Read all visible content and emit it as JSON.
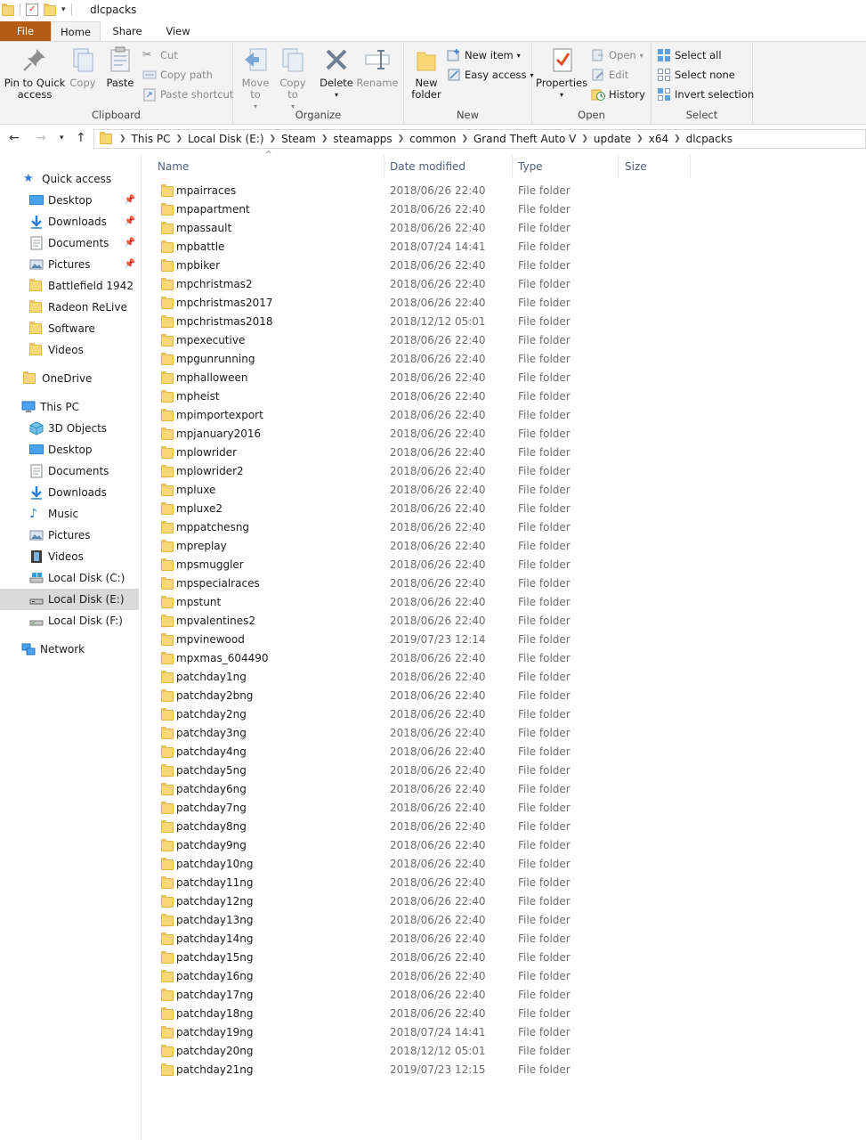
{
  "window": {
    "title": "dlcpacks",
    "qat_dropdown_icon": "chevron-down-icon"
  },
  "ribbon_tabs": {
    "file": "File",
    "home": "Home",
    "share": "Share",
    "view": "View"
  },
  "ribbon": {
    "clipboard": {
      "label": "Clipboard",
      "pin_to_quick_access": "Pin to Quick access",
      "copy": "Copy",
      "paste": "Paste",
      "cut": "Cut",
      "copy_path": "Copy path",
      "paste_shortcut": "Paste shortcut"
    },
    "organize": {
      "label": "Organize",
      "move_to": "Move to",
      "copy_to": "Copy to",
      "delete": "Delete",
      "rename": "Rename"
    },
    "new": {
      "label": "New",
      "new_folder": "New folder",
      "new_item": "New item",
      "easy_access": "Easy access"
    },
    "open": {
      "label": "Open",
      "properties": "Properties",
      "open": "Open",
      "edit": "Edit",
      "history": "History"
    },
    "select": {
      "label": "Select",
      "select_all": "Select all",
      "select_none": "Select none",
      "invert_selection": "Invert selection"
    }
  },
  "address": {
    "crumbs": [
      "This PC",
      "Local Disk (E:)",
      "Steam",
      "steamapps",
      "common",
      "Grand Theft Auto V",
      "update",
      "x64",
      "dlcpacks"
    ]
  },
  "nav": {
    "quick_access": "Quick access",
    "quick_items": [
      "Desktop",
      "Downloads",
      "Documents",
      "Pictures",
      "Battlefield 1942",
      "Radeon ReLive",
      "Software",
      "Videos"
    ],
    "onedrive": "OneDrive",
    "this_pc": "This PC",
    "pc_items": [
      "3D Objects",
      "Desktop",
      "Documents",
      "Downloads",
      "Music",
      "Pictures",
      "Videos",
      "Local Disk (C:)",
      "Local Disk (E:)",
      "Local Disk (F:)"
    ],
    "network": "Network",
    "selected": "Local Disk (E:)"
  },
  "columns": {
    "name": "Name",
    "date_modified": "Date modified",
    "type": "Type",
    "size": "Size"
  },
  "files": [
    {
      "name": "mpairraces",
      "date": "2018/06/26 22:40",
      "type": "File folder"
    },
    {
      "name": "mpapartment",
      "date": "2018/06/26 22:40",
      "type": "File folder"
    },
    {
      "name": "mpassault",
      "date": "2018/06/26 22:40",
      "type": "File folder"
    },
    {
      "name": "mpbattle",
      "date": "2018/07/24 14:41",
      "type": "File folder"
    },
    {
      "name": "mpbiker",
      "date": "2018/06/26 22:40",
      "type": "File folder"
    },
    {
      "name": "mpchristmas2",
      "date": "2018/06/26 22:40",
      "type": "File folder"
    },
    {
      "name": "mpchristmas2017",
      "date": "2018/06/26 22:40",
      "type": "File folder"
    },
    {
      "name": "mpchristmas2018",
      "date": "2018/12/12 05:01",
      "type": "File folder"
    },
    {
      "name": "mpexecutive",
      "date": "2018/06/26 22:40",
      "type": "File folder"
    },
    {
      "name": "mpgunrunning",
      "date": "2018/06/26 22:40",
      "type": "File folder"
    },
    {
      "name": "mphalloween",
      "date": "2018/06/26 22:40",
      "type": "File folder"
    },
    {
      "name": "mpheist",
      "date": "2018/06/26 22:40",
      "type": "File folder"
    },
    {
      "name": "mpimportexport",
      "date": "2018/06/26 22:40",
      "type": "File folder"
    },
    {
      "name": "mpjanuary2016",
      "date": "2018/06/26 22:40",
      "type": "File folder"
    },
    {
      "name": "mplowrider",
      "date": "2018/06/26 22:40",
      "type": "File folder"
    },
    {
      "name": "mplowrider2",
      "date": "2018/06/26 22:40",
      "type": "File folder"
    },
    {
      "name": "mpluxe",
      "date": "2018/06/26 22:40",
      "type": "File folder"
    },
    {
      "name": "mpluxe2",
      "date": "2018/06/26 22:40",
      "type": "File folder"
    },
    {
      "name": "mppatchesng",
      "date": "2018/06/26 22:40",
      "type": "File folder"
    },
    {
      "name": "mpreplay",
      "date": "2018/06/26 22:40",
      "type": "File folder"
    },
    {
      "name": "mpsmuggler",
      "date": "2018/06/26 22:40",
      "type": "File folder"
    },
    {
      "name": "mpspecialraces",
      "date": "2018/06/26 22:40",
      "type": "File folder"
    },
    {
      "name": "mpstunt",
      "date": "2018/06/26 22:40",
      "type": "File folder"
    },
    {
      "name": "mpvalentines2",
      "date": "2018/06/26 22:40",
      "type": "File folder"
    },
    {
      "name": "mpvinewood",
      "date": "2019/07/23 12:14",
      "type": "File folder"
    },
    {
      "name": "mpxmas_604490",
      "date": "2018/06/26 22:40",
      "type": "File folder"
    },
    {
      "name": "patchday1ng",
      "date": "2018/06/26 22:40",
      "type": "File folder"
    },
    {
      "name": "patchday2bng",
      "date": "2018/06/26 22:40",
      "type": "File folder"
    },
    {
      "name": "patchday2ng",
      "date": "2018/06/26 22:40",
      "type": "File folder"
    },
    {
      "name": "patchday3ng",
      "date": "2018/06/26 22:40",
      "type": "File folder"
    },
    {
      "name": "patchday4ng",
      "date": "2018/06/26 22:40",
      "type": "File folder"
    },
    {
      "name": "patchday5ng",
      "date": "2018/06/26 22:40",
      "type": "File folder"
    },
    {
      "name": "patchday6ng",
      "date": "2018/06/26 22:40",
      "type": "File folder"
    },
    {
      "name": "patchday7ng",
      "date": "2018/06/26 22:40",
      "type": "File folder"
    },
    {
      "name": "patchday8ng",
      "date": "2018/06/26 22:40",
      "type": "File folder"
    },
    {
      "name": "patchday9ng",
      "date": "2018/06/26 22:40",
      "type": "File folder"
    },
    {
      "name": "patchday10ng",
      "date": "2018/06/26 22:40",
      "type": "File folder"
    },
    {
      "name": "patchday11ng",
      "date": "2018/06/26 22:40",
      "type": "File folder"
    },
    {
      "name": "patchday12ng",
      "date": "2018/06/26 22:40",
      "type": "File folder"
    },
    {
      "name": "patchday13ng",
      "date": "2018/06/26 22:40",
      "type": "File folder"
    },
    {
      "name": "patchday14ng",
      "date": "2018/06/26 22:40",
      "type": "File folder"
    },
    {
      "name": "patchday15ng",
      "date": "2018/06/26 22:40",
      "type": "File folder"
    },
    {
      "name": "patchday16ng",
      "date": "2018/06/26 22:40",
      "type": "File folder"
    },
    {
      "name": "patchday17ng",
      "date": "2018/06/26 22:40",
      "type": "File folder"
    },
    {
      "name": "patchday18ng",
      "date": "2018/06/26 22:40",
      "type": "File folder"
    },
    {
      "name": "patchday19ng",
      "date": "2018/07/24 14:41",
      "type": "File folder"
    },
    {
      "name": "patchday20ng",
      "date": "2018/12/12 05:01",
      "type": "File folder"
    },
    {
      "name": "patchday21ng",
      "date": "2019/07/23 12:15",
      "type": "File folder"
    }
  ],
  "colors": {
    "file_tab": "#b35b14",
    "folder": "#f8d876",
    "column_header_text": "#4c607a",
    "accent": "#0078d7"
  }
}
